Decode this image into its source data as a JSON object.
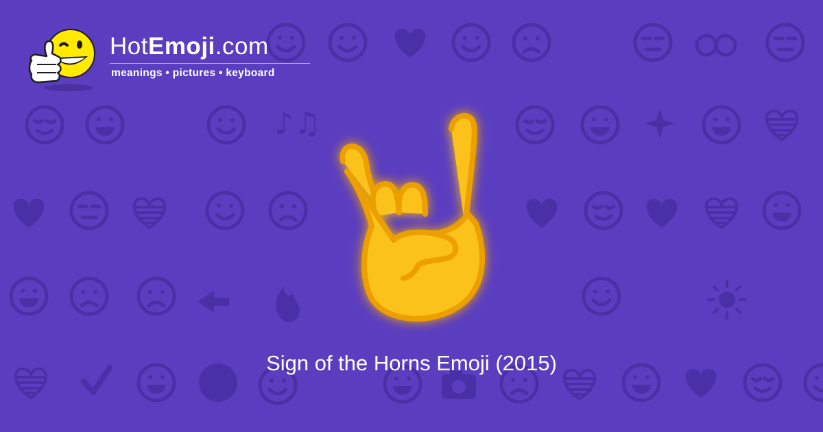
{
  "brand": {
    "name_light_1": "Hot",
    "name_bold": "Emoji",
    "name_light_2": ".com",
    "tagline": "meanings • pictures • keyboard",
    "mascot_icon": "winking-thumbs-up-face-icon"
  },
  "hero": {
    "icon": "sign-of-the-horns-icon",
    "caption": "Sign of the Horns Emoji (2015)"
  },
  "colors": {
    "background": "#5b3ebf",
    "pattern_icon": "#4a30a6",
    "text": "#ffffff",
    "emoji_yellow": "#fcc21b",
    "emoji_outline": "#eba000"
  },
  "background_pattern": {
    "rows": [
      [
        "smiling-face-icon",
        "beaming-face-icon",
        "smiling-face-icon",
        "winking-face-icon",
        "kissing-face-icon",
        "two-hearts-icon",
        "smiling-face-icon",
        "persevering-face-icon",
        "ok-hand-icon",
        "neutral-face-icon",
        "eyes-icon",
        "smirking-face-icon"
      ],
      [
        "relieved-face-icon",
        "grimacing-face-icon",
        "recycle-icon",
        "raising-hands-icon",
        "musical-notes-icon",
        "see-no-evil-monkey-icon",
        "victory-hand-icon",
        "sleeping-face-icon",
        "worried-face-icon",
        "grinning-face-icon",
        "sparkles-icon",
        "grinning-face-icon",
        "striped-heart-icon"
      ],
      [
        "broken-heart-icon",
        "confused-face-icon",
        "striped-heart-icon",
        "tongue-wink-face-icon",
        "frowning-face-icon",
        "smiling-face-icon",
        "heart-arrow-icon",
        "tired-face-icon",
        "revolving-hearts-icon",
        "heart-icon",
        "speak-no-evil-monkey-icon"
      ],
      [
        "screaming-face-icon",
        "smiling-devil-icon",
        "angry-face-icon",
        "left-arrow-icon",
        "fire-icon",
        "smiling-face-icon",
        "party-popper-icon",
        "tongue-squint-face-icon",
        "rose-icon",
        "sun-icon",
        "flexed-biceps-icon"
      ],
      [
        "striped-heart-icon",
        "check-mark-icon",
        "squinting-face-icon",
        "full-moon-face-icon",
        "cat-face-icon",
        "waving-hand-icon",
        "medical-mask-face-icon",
        "camera-icon",
        "worried-face-icon",
        "striped-heart-icon",
        "grimacing-face-icon",
        "beating-heart-icon",
        "relieved-face-icon",
        "kissing-face-icon"
      ]
    ]
  }
}
